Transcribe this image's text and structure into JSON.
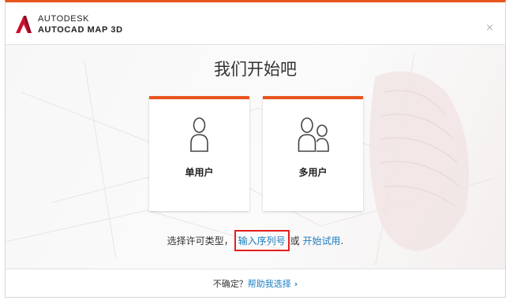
{
  "header": {
    "brand": "AUTODESK",
    "product": "AUTOCAD MAP 3D",
    "close_symbol": "×",
    "accent_color": "#e8541d"
  },
  "main": {
    "title": "我们开始吧",
    "cards": [
      {
        "label": "单用户",
        "icon": "single-user-icon"
      },
      {
        "label": "多用户",
        "icon": "multi-user-icon"
      }
    ],
    "license": {
      "prefix": "选择许可类型，",
      "serial_link": "输入序列号",
      "connector": "或",
      "trial_link": "开始试用",
      "suffix": "."
    }
  },
  "footer": {
    "question": "不确定？",
    "help_link": "帮助我选择",
    "chevron": "›"
  },
  "colors": {
    "link": "#1a7ec2",
    "highlight_border": "#e41f1f"
  }
}
